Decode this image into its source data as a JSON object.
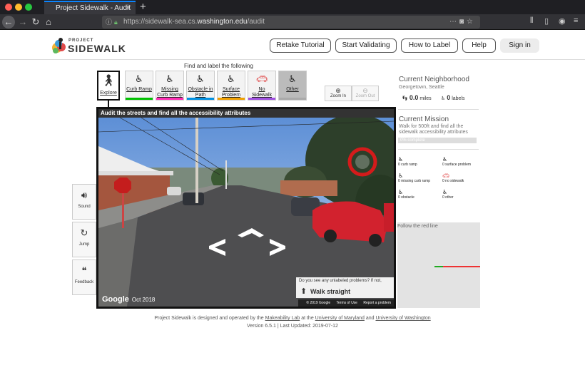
{
  "browser": {
    "tab_title": "Project Sidewalk - Audit",
    "tab_close": "✕",
    "new_tab": "+",
    "url_prefix": "https://sidewalk-sea.cs.",
    "url_host": "washington.edu",
    "url_path": "/audit",
    "back": "←",
    "forward": "→",
    "reload": "↻",
    "home": "⌂"
  },
  "nav": {
    "logo_small": "PROJECT",
    "logo_big": "SIDEWALK",
    "buttons": [
      "Retake Tutorial",
      "Start Validating",
      "How to Label",
      "Help"
    ],
    "sign_in": "Sign in"
  },
  "tools": {
    "heading": "Find and label the following",
    "explore": "Explore",
    "items": [
      {
        "label": "Curb Ramp",
        "color": "#00c000"
      },
      {
        "label": "Missing Curb Ramp",
        "color": "#ff2db4"
      },
      {
        "label": "Obstacle in Path",
        "color": "#0090e0"
      },
      {
        "label": "Surface Problem",
        "color": "#f0a000"
      },
      {
        "label": "No Sidewalk",
        "color": "#a050e0"
      },
      {
        "label": "Other",
        "color": "#aaaaaa"
      }
    ],
    "zoom_in": "Zoom In",
    "zoom_out": "Zoom Out"
  },
  "streetview": {
    "title": "Audit the streets and find all the accessibility attributes",
    "google": "Google",
    "date": "Oct 2018",
    "hint_question": "Do you see any unlabeled problems? If not,",
    "hint_action": "Walk straight",
    "footer": [
      "© 2019 Google",
      "Terms of Use",
      "Report a problem"
    ]
  },
  "side_buttons": [
    "Sound",
    "Jump",
    "Feedback"
  ],
  "neighborhood": {
    "heading": "Current Neighborhood",
    "name": "Georgetown, Seattle",
    "miles": "0.0",
    "miles_unit": "miles",
    "labels": "0",
    "labels_unit": "labels"
  },
  "mission": {
    "heading": "Current Mission",
    "description": "Walk for 500ft and find all the sidewalk accessibility attributes",
    "progress_text": "0% complete",
    "progress": 0
  },
  "counts": [
    "0 curb ramp",
    "0 surface problem",
    "0 missing curb ramp",
    "0 no sidewalk",
    "0 obstacle",
    "0 other"
  ],
  "minimap": {
    "caption": "Follow the red line"
  },
  "footer": {
    "line1_a": "Project Sidewalk is designed and operated by the ",
    "lab": "Makeability Lab",
    "line1_b": " at the ",
    "umd": "University of Maryland",
    "line1_c": " and ",
    "uw": "University of Washington",
    "line2": "Version 6.5.1 | Last Updated: 2019-07-12"
  }
}
